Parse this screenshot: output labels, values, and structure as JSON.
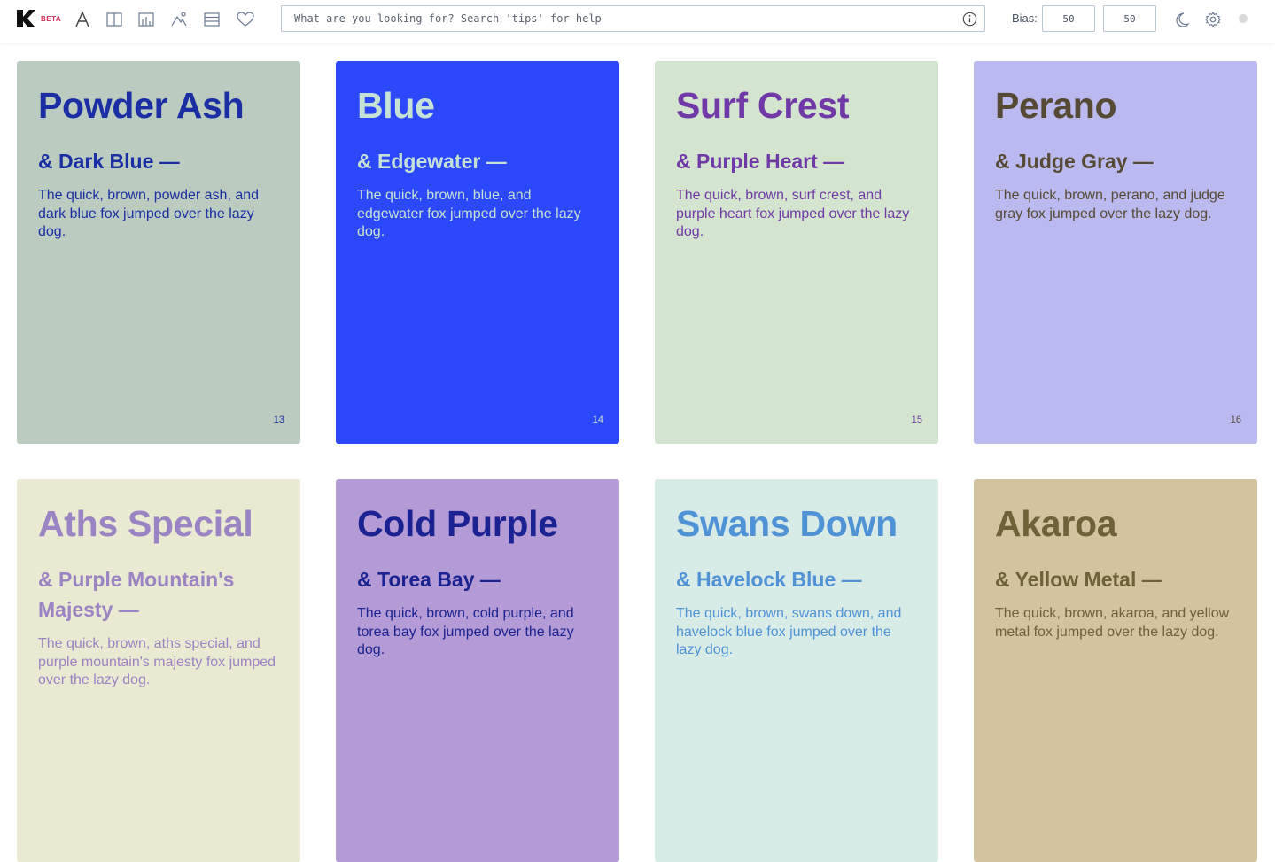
{
  "app": {
    "logo_badge": "BETA",
    "brand_color": "#d12a4f"
  },
  "toolbar": {
    "icons": [
      "typography-icon",
      "columns-icon",
      "chart-icon",
      "gradient-icon",
      "list-icon",
      "heart-icon"
    ]
  },
  "search": {
    "placeholder": "What are you looking for? Search 'tips' for help",
    "value": ""
  },
  "bias": {
    "label": "Bias:",
    "value_1": "50",
    "value_2": "50"
  },
  "cards": [
    {
      "title": "Powder Ash",
      "subtitle": "& Dark Blue —",
      "body": "The quick, brown, powder ash, and dark blue fox jumped over the lazy dog.",
      "number": "13",
      "bg": "#bccbbf",
      "fg": "#1b2ea3"
    },
    {
      "title": "Blue",
      "subtitle": "& Edgewater —",
      "body": "The quick, brown, blue, and edgewater fox jumped over the lazy dog.",
      "number": "14",
      "bg": "#2b48fb",
      "fg": "#c6e2d6"
    },
    {
      "title": "Surf Crest",
      "subtitle": "& Purple Heart —",
      "body": "The quick, brown, surf crest, and purple heart fox jumped over the lazy dog.",
      "number": "15",
      "bg": "#d3e5ce",
      "fg": "#7139a8"
    },
    {
      "title": "Perano",
      "subtitle": "& Judge Gray —",
      "body": "The quick, brown, perano, and judge gray fox jumped over the lazy dog.",
      "number": "16",
      "bg": "#babaf0",
      "fg": "#574a34"
    },
    {
      "title": "Aths Special",
      "subtitle": "& Purple Mountain's Majesty —",
      "body": "The quick, brown, aths special, and purple mountain's majesty fox jumped over the lazy dog.",
      "number": "",
      "bg": "#eae9d2",
      "fg": "#9b84c3"
    },
    {
      "title": "Cold Purple",
      "subtitle": "& Torea Bay —",
      "body": "The quick, brown, cold purple, and torea bay fox jumped over the lazy dog.",
      "number": "",
      "bg": "#b59bd6",
      "fg": "#1a2391"
    },
    {
      "title": "Swans Down",
      "subtitle": "& Havelock Blue —",
      "body": "The quick, brown, swans down, and havelock blue fox jumped over the lazy dog.",
      "number": "",
      "bg": "#d9ebe7",
      "fg": "#4f93d6"
    },
    {
      "title": "Akaroa",
      "subtitle": "& Yellow Metal —",
      "body": "The quick, brown, akaroa, and yellow metal fox jumped over the lazy dog.",
      "number": "",
      "bg": "#d3c4a0",
      "fg": "#6e6238"
    }
  ]
}
